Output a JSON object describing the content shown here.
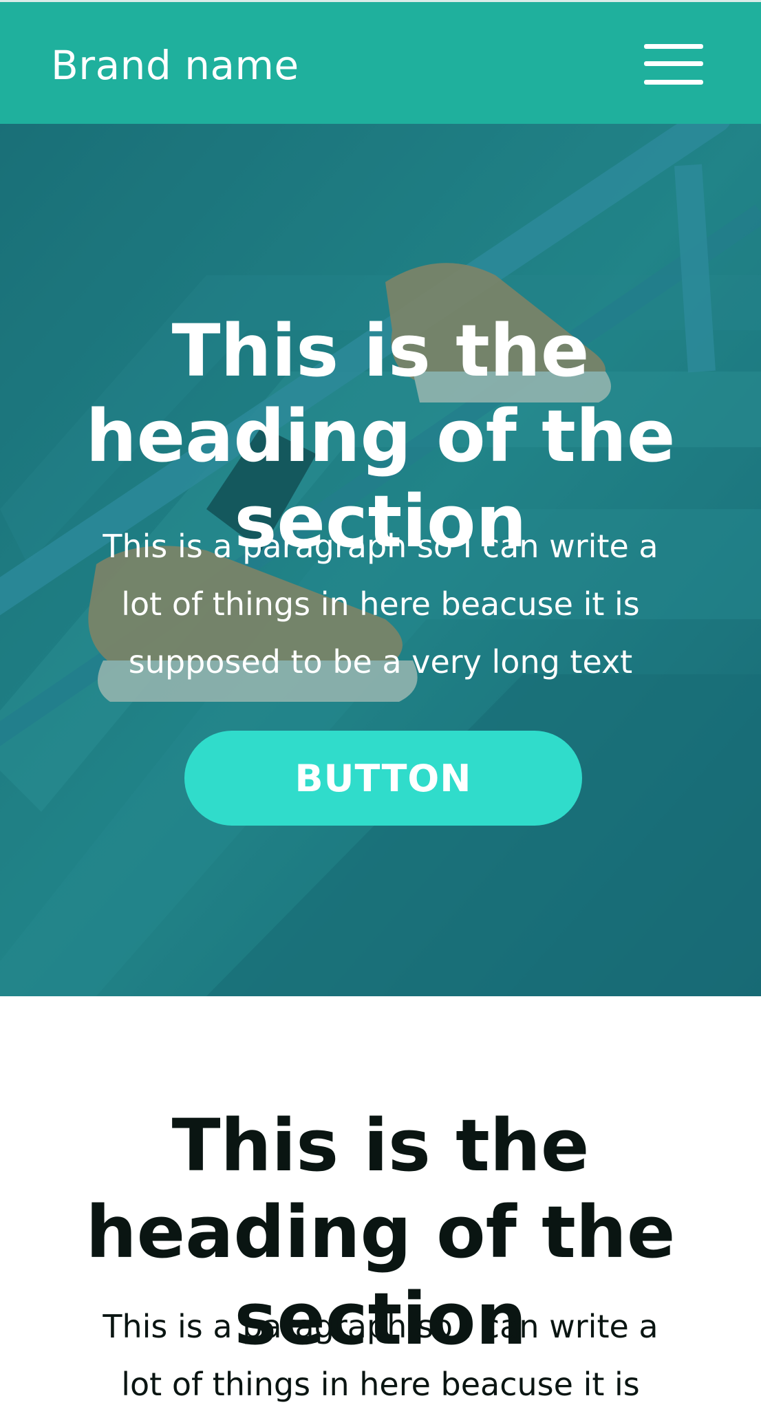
{
  "navbar": {
    "brand": "Brand name",
    "menu_icon": "hamburger-menu-icon",
    "background_color": "#1fb09d"
  },
  "hero": {
    "background_image": "stairs-with-sneakers-photo",
    "heading": "This is the heading of the section",
    "paragraph": "This is a paragraph so I can write a lot of things in here beacuse it is supposed to be a very long text",
    "button_label": "BUTTON",
    "button_color": "#30dccb"
  },
  "section": {
    "heading": "This is the heading of the section",
    "paragraph": "This is a paragraph so I can write a lot of things in here beacuse it is supposed to be a very long text"
  }
}
